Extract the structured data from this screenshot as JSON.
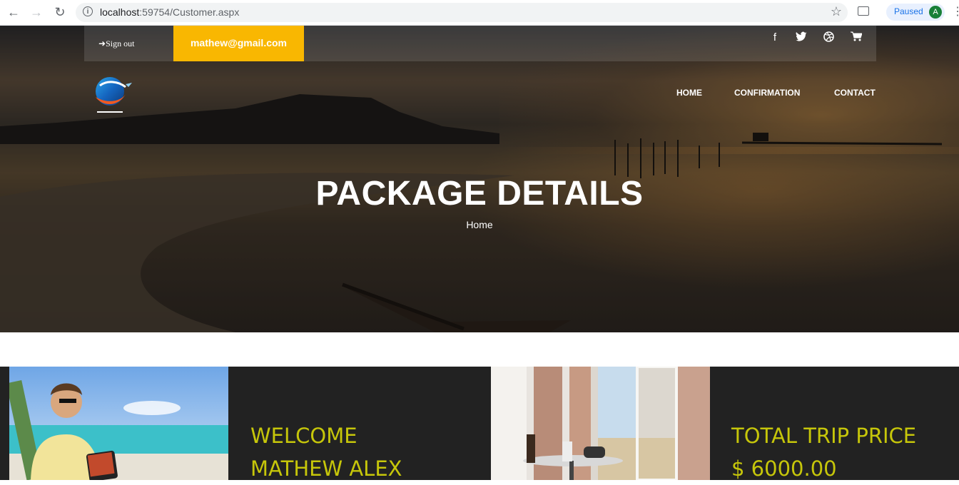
{
  "browser": {
    "url_host": "localhost",
    "url_rest": ":59754/Customer.aspx",
    "paused_label": "Paused",
    "avatar_letter": "A"
  },
  "topbar": {
    "signout_label": "Sign out",
    "email": "mathew@gmail.com",
    "social_icons": [
      "facebook-icon",
      "twitter-icon",
      "dribbble-icon",
      "cart-icon"
    ]
  },
  "nav": {
    "items": [
      {
        "label": "HOME"
      },
      {
        "label": "CONFIRMATION"
      },
      {
        "label": "CONTACT"
      }
    ]
  },
  "hero": {
    "title": "PACKAGE DETAILS",
    "breadcrumb": "Home"
  },
  "welcome": {
    "line1": "WELCOME",
    "line2": "MATHEW ALEX"
  },
  "price": {
    "line1": "TOTAL TRIP PRICE",
    "line2": "$ 6000.00"
  },
  "colors": {
    "accent": "#f9b701",
    "info_text": "#c6c60a",
    "strip_bg": "#222222"
  }
}
